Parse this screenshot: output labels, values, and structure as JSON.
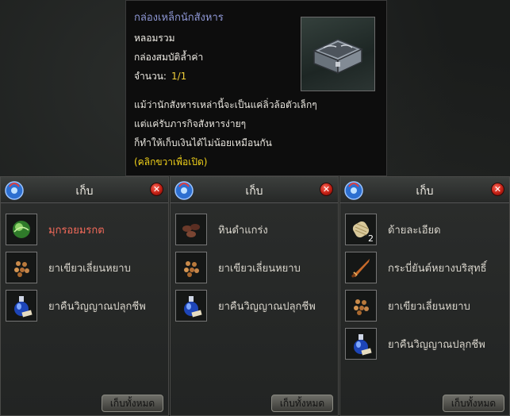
{
  "tooltip": {
    "title": "กล่องเหล็กนักสังหาร",
    "line1": "หลอมรวม",
    "line2": "กล่องสมบัติล้ำค่า",
    "count_label": "จำนวน:",
    "count_value": "1/1",
    "desc1": "แม้ว่านักสังหารเหล่านี้จะเป็นแค่ลิ่วล้อตัวเล็กๆ",
    "desc2": "แต่แค่รับภารกิจสังหารง่ายๆ",
    "desc3": "ก็ทำให้เก็บเงินได้ไม่น้อยเหมือนกัน",
    "hint": "(คลิกขวาเพื่อเปิด)",
    "image_icon": "iron-chest-icon"
  },
  "panels": [
    {
      "title": "เก็บ",
      "take_all": "เก็บทั้งหมด",
      "items": [
        {
          "name": "มุกรอยมรกต",
          "icon": "emerald-pearl-icon",
          "qty": ""
        },
        {
          "name": "ยาเขียวเลี่ยนหยาบ",
          "icon": "pills-icon",
          "qty": ""
        },
        {
          "name": "ยาคืนวิญญาณปลุกชีพ",
          "icon": "blue-potion-icon",
          "qty": ""
        }
      ]
    },
    {
      "title": "เก็บ",
      "take_all": "เก็บทั้งหมด",
      "items": [
        {
          "name": "หินดำแกร่ง",
          "icon": "black-stones-icon",
          "qty": ""
        },
        {
          "name": "ยาเขียวเลี่ยนหยาบ",
          "icon": "pills-icon",
          "qty": ""
        },
        {
          "name": "ยาคืนวิญญาณปลุกชีพ",
          "icon": "blue-potion-icon",
          "qty": ""
        }
      ]
    },
    {
      "title": "เก็บ",
      "take_all": "เก็บทั้งหมด",
      "items": [
        {
          "name": "ด้ายละเอียด",
          "icon": "thread-spool-icon",
          "qty": "2"
        },
        {
          "name": "กระบี่ยันต์หยางบริสุทธิ์",
          "icon": "sword-icon",
          "qty": ""
        },
        {
          "name": "ยาเขียวเลี่ยนหยาบ",
          "icon": "pills-icon",
          "qty": ""
        },
        {
          "name": "ยาคืนวิญญาณปลุกชีพ",
          "icon": "blue-potion-icon",
          "qty": ""
        }
      ]
    }
  ],
  "colors": {
    "item_name_highlight": "#f26a5a",
    "tooltip_title": "#8f98d6",
    "hint": "#f2d21a"
  }
}
